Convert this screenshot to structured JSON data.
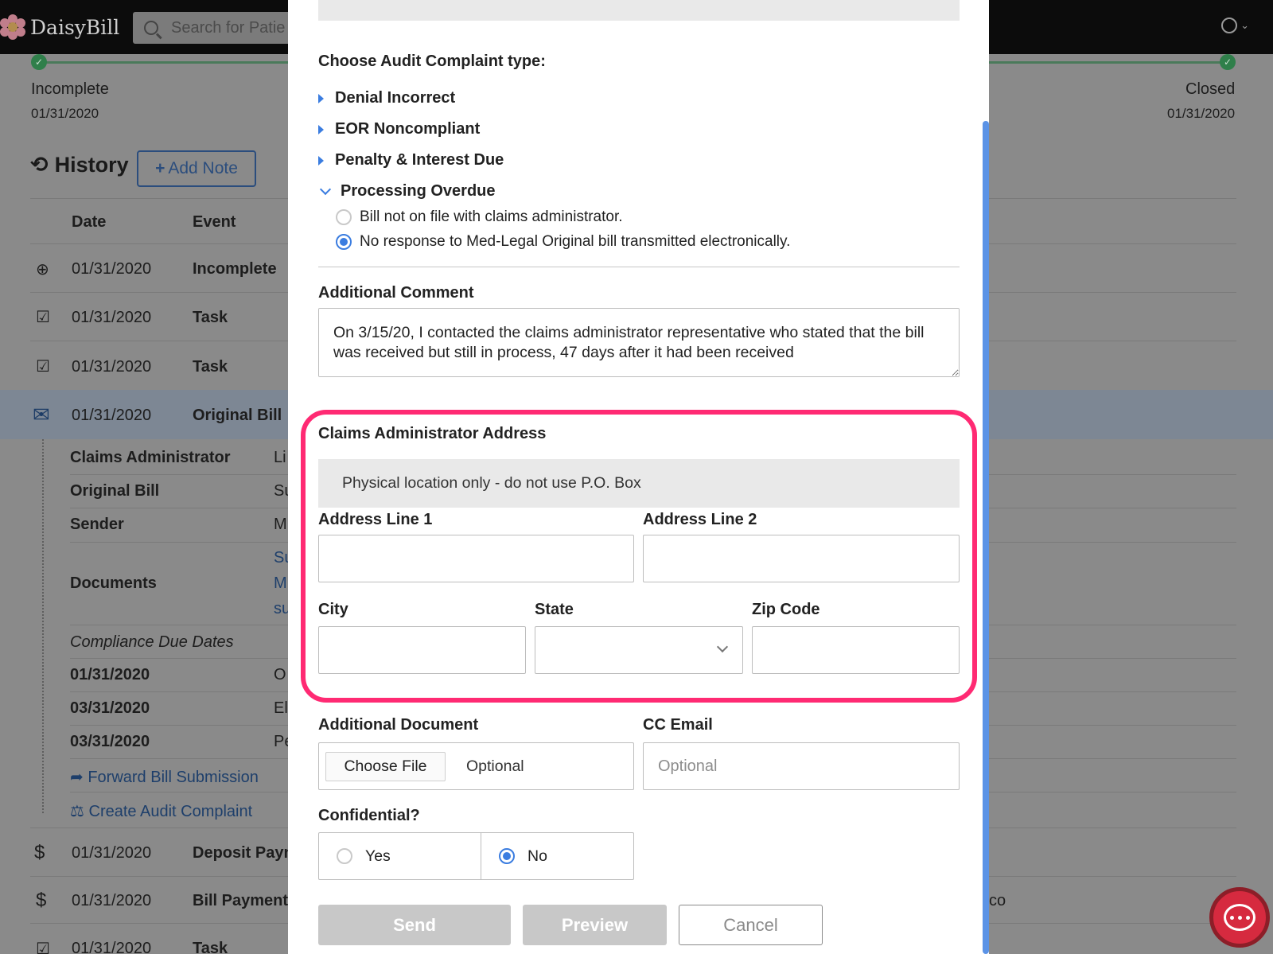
{
  "app": {
    "name": "DaisyBill"
  },
  "header": {
    "search_placeholder": "Search for Patie"
  },
  "status": {
    "left_label": "Incomplete",
    "left_date": "01/31/2020",
    "right_label": "Closed",
    "right_date": "01/31/2020"
  },
  "history": {
    "title": "History",
    "add_note_label": "Add Note",
    "columns": [
      "Date",
      "Event"
    ],
    "rows": [
      {
        "date": "01/31/2020",
        "event": "Incomplete"
      },
      {
        "date": "01/31/2020",
        "event": "Task"
      },
      {
        "date": "01/31/2020",
        "event": "Task"
      },
      {
        "date": "01/31/2020",
        "event": "Original Bill"
      },
      {
        "date": "01/31/2020",
        "event": "Deposit Payn"
      },
      {
        "date": "01/31/2020",
        "event": "Bill Payment"
      },
      {
        "date": "01/31/2020",
        "event": "Task"
      }
    ],
    "details": [
      {
        "label": "Claims Administrator",
        "value": "Li"
      },
      {
        "label": "Original Bill",
        "value": "Su"
      },
      {
        "label": "Sender",
        "value": "M"
      },
      {
        "label": "Documents",
        "value": "M"
      }
    ],
    "documents_extra": [
      "Su",
      "su"
    ],
    "compliance_title": "Compliance Due Dates",
    "compliance": [
      {
        "date": "01/31/2020",
        "value": "O"
      },
      {
        "date": "03/31/2020",
        "value": "El"
      },
      {
        "date": "03/31/2020",
        "value": "Pe"
      }
    ],
    "forward_link": "Forward Bill Submission",
    "audit_link": "Create Audit Complaint",
    "right_fragment": "co"
  },
  "modal": {
    "complaint_type_label": "Choose Audit Complaint type:",
    "types": [
      {
        "label": "Denial Incorrect",
        "expanded": false
      },
      {
        "label": "EOR Noncompliant",
        "expanded": false
      },
      {
        "label": "Penalty & Interest Due",
        "expanded": false
      },
      {
        "label": "Processing Overdue",
        "expanded": true
      }
    ],
    "options": [
      {
        "label": "Bill not on file with claims administrator.",
        "checked": false
      },
      {
        "label": "No response to Med-Legal Original bill transmitted electronically.",
        "checked": true
      }
    ],
    "comment_label": "Additional Comment",
    "comment_value": "On 3/15/20, I contacted the claims administrator representative who stated that the bill was received but still in process, 47 days after it had been received",
    "address": {
      "title": "Claims Administrator Address",
      "banner": "Physical location only - do not use P.O. Box",
      "line1_label": "Address Line 1",
      "line2_label": "Address Line 2",
      "city_label": "City",
      "state_label": "State",
      "zip_label": "Zip Code"
    },
    "document_label": "Additional Document",
    "choose_file": "Choose File",
    "document_optional": "Optional",
    "cc_label": "CC Email",
    "cc_placeholder": "Optional",
    "confidential_label": "Confidential?",
    "confidential_yes": "Yes",
    "confidential_no": "No",
    "send_label": "Send",
    "preview_label": "Preview",
    "cancel_label": "Cancel"
  },
  "colors": {
    "accent": "#3b7de0",
    "highlight": "#ff2a73",
    "chat": "#d62a3f"
  }
}
